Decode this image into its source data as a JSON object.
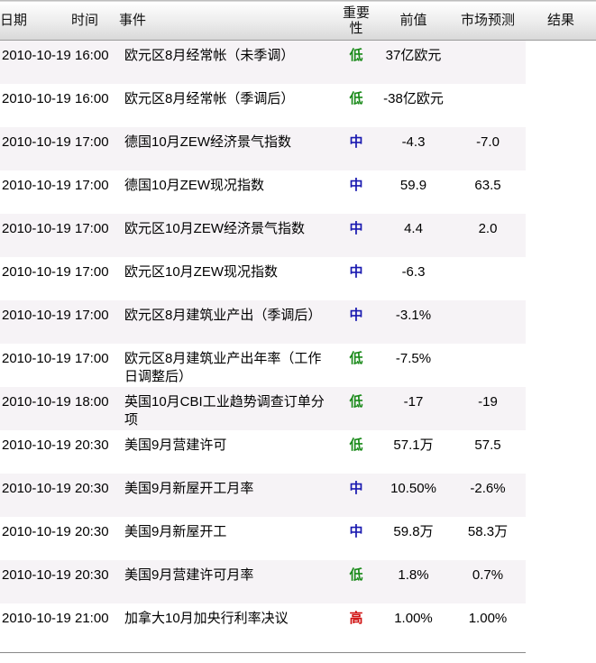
{
  "header": {
    "date": "日期",
    "time": "时间",
    "event": "事件",
    "importance_line1": "重要",
    "importance_line2": "性",
    "previous": "前值",
    "forecast": "市场预测",
    "result": "结果"
  },
  "rows": [
    {
      "date": "2010-10-19",
      "time": "16:00",
      "event": "欧元区8月经常帐（未季调）",
      "importance": "低",
      "level": "low",
      "previous": "37亿欧元",
      "forecast": "",
      "result": ""
    },
    {
      "date": "2010-10-19",
      "time": "16:00",
      "event": "欧元区8月经常帐（季调后）",
      "importance": "低",
      "level": "low",
      "previous": "-38亿欧元",
      "forecast": "",
      "result": ""
    },
    {
      "date": "2010-10-19",
      "time": "17:00",
      "event": "德国10月ZEW经济景气指数",
      "importance": "中",
      "level": "mid",
      "previous": "-4.3",
      "forecast": "-7.0",
      "result": ""
    },
    {
      "date": "2010-10-19",
      "time": "17:00",
      "event": "德国10月ZEW现况指数",
      "importance": "中",
      "level": "mid",
      "previous": "59.9",
      "forecast": "63.5",
      "result": ""
    },
    {
      "date": "2010-10-19",
      "time": "17:00",
      "event": "欧元区10月ZEW经济景气指数",
      "importance": "中",
      "level": "mid",
      "previous": "4.4",
      "forecast": "2.0",
      "result": ""
    },
    {
      "date": "2010-10-19",
      "time": "17:00",
      "event": "欧元区10月ZEW现况指数",
      "importance": "中",
      "level": "mid",
      "previous": "-6.3",
      "forecast": "",
      "result": ""
    },
    {
      "date": "2010-10-19",
      "time": "17:00",
      "event": "欧元区8月建筑业产出（季调后）",
      "importance": "中",
      "level": "mid",
      "previous": "-3.1%",
      "forecast": "",
      "result": ""
    },
    {
      "date": "2010-10-19",
      "time": "17:00",
      "event": "欧元区8月建筑业产出年率（工作日调整后）",
      "importance": "低",
      "level": "low",
      "previous": "-7.5%",
      "forecast": "",
      "result": ""
    },
    {
      "date": "2010-10-19",
      "time": "18:00",
      "event": "英国10月CBI工业趋势调查订单分项",
      "importance": "低",
      "level": "low",
      "previous": "-17",
      "forecast": "-19",
      "result": ""
    },
    {
      "date": "2010-10-19",
      "time": "20:30",
      "event": "美国9月营建许可",
      "importance": "低",
      "level": "low",
      "previous": "57.1万",
      "forecast": "57.5",
      "result": ""
    },
    {
      "date": "2010-10-19",
      "time": "20:30",
      "event": "美国9月新屋开工月率",
      "importance": "中",
      "level": "mid",
      "previous": "10.50%",
      "forecast": "-2.6%",
      "result": ""
    },
    {
      "date": "2010-10-19",
      "time": "20:30",
      "event": "美国9月新屋开工",
      "importance": "中",
      "level": "mid",
      "previous": "59.8万",
      "forecast": "58.3万",
      "result": ""
    },
    {
      "date": "2010-10-19",
      "time": "20:30",
      "event": "美国9月营建许可月率",
      "importance": "低",
      "level": "low",
      "previous": "1.8%",
      "forecast": "0.7%",
      "result": ""
    },
    {
      "date": "2010-10-19",
      "time": "21:00",
      "event": "加拿大10月加央行利率决议",
      "importance": "高",
      "level": "high",
      "previous": "1.00%",
      "forecast": "1.00%",
      "result": ""
    }
  ],
  "colors": {
    "low": "#1a8a1a",
    "mid": "#1a1ab0",
    "high": "#d01010"
  }
}
